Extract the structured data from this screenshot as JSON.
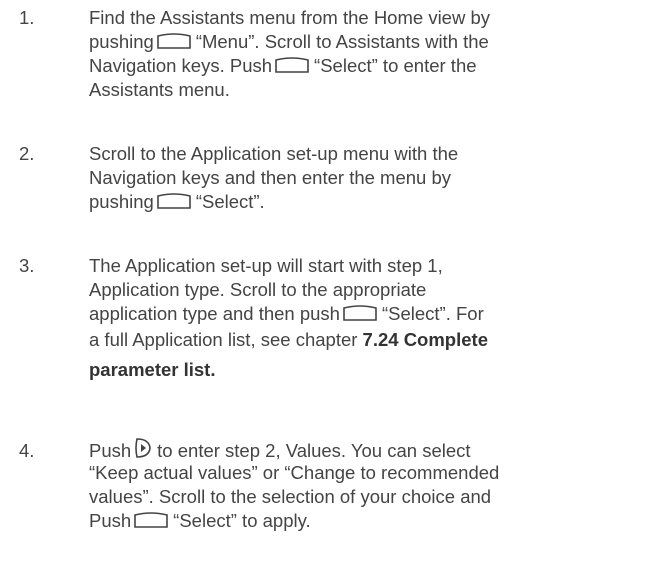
{
  "icons": {
    "soft_key": "soft-key-icon",
    "nav_right": "navigation-right-icon"
  },
  "steps": [
    {
      "number": "1.",
      "line1": "Find the Assistants menu from the Home view by",
      "line2a": "pushing",
      "line2b": "“Menu”. Scroll to Assistants with the",
      "line3a": "Navigation keys. Push",
      "line3b": "“Select” to enter the",
      "line4": "Assistants menu."
    },
    {
      "number": "2.",
      "line1": "Scroll to the Application set-up menu with the",
      "line2": "Navigation keys and then enter the menu by",
      "line3a": "pushing",
      "line3b": "“Select”."
    },
    {
      "number": "3.",
      "line1": "The Application set-up will start with step 1,",
      "line2": "Application type. Scroll to the appropriate",
      "line3a": "application type and then push",
      "line3b": "“Select”. For",
      "line4a": "a full Application list, see chapter",
      "line4b": "7.24 Complete",
      "line5": "parameter list."
    },
    {
      "number": "4.",
      "line1a": "Push",
      "line1b": "to enter step 2, Values. You can select",
      "line2": "“Keep actual values” or “Change to recommended",
      "line3": "values”. Scroll to the selection of your choice and",
      "line4a": "Push",
      "line4b": "“Select” to apply."
    }
  ]
}
